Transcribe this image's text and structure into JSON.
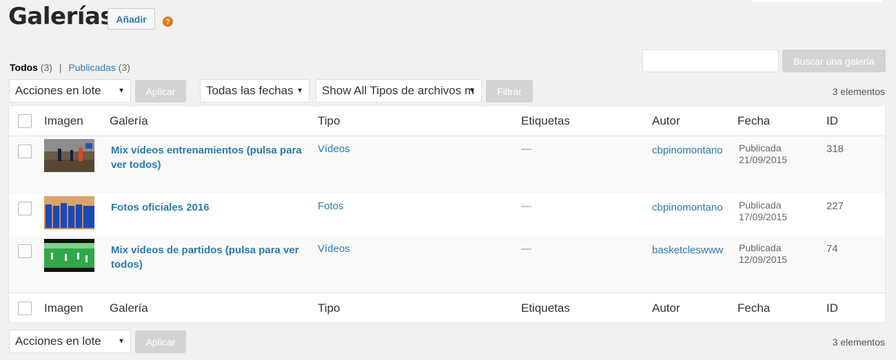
{
  "header": {
    "title": "Galerías",
    "add_label": "Añadir",
    "help_icon": "?"
  },
  "status_links": {
    "all_label": "Todos",
    "all_count": "(3)",
    "separator": "|",
    "published_label": "Publicadas",
    "published_count": "(3)"
  },
  "search": {
    "value": "",
    "button_label": "Buscar una galería"
  },
  "top_nav": {
    "bulk_action": "Acciones en lote",
    "apply_label": "Aplicar",
    "date_filter": "Todas las fechas",
    "type_filter": "Show All Tipos de archivos m",
    "filter_label": "Filtrar",
    "count": "3 elementos"
  },
  "bottom_nav": {
    "bulk_action": "Acciones en lote",
    "apply_label": "Aplicar",
    "count": "3 elementos"
  },
  "columns": {
    "image": "Imagen",
    "gallery": "Galería",
    "type": "Tipo",
    "tags": "Etiquetas",
    "author": "Autor",
    "date": "Fecha",
    "id": "ID"
  },
  "rows": [
    {
      "title": "Mix vídeos entrenamientos (pulsa para ver todos)",
      "type": "Vídeos",
      "tags": "—",
      "author": "cbpinomontano",
      "status": "Publicada",
      "date": "21/09/2015",
      "id": "318"
    },
    {
      "title": "Fotos oficiales 2016",
      "type": "Fotos",
      "tags": "—",
      "author": "cbpinomontano",
      "status": "Publicada",
      "date": "17/09/2015",
      "id": "227"
    },
    {
      "title": "Mix vídeos de partidos (pulsa para ver todos)",
      "type": "Vídeos",
      "tags": "—",
      "author": "basketcleswww",
      "status": "Publicada",
      "date": "12/09/2015",
      "id": "74"
    }
  ],
  "colors": {
    "link": "#2a7ab0",
    "background": "#f1f1f1",
    "help_icon": "#e0781e",
    "disabled_button": "#d3d3d3"
  }
}
